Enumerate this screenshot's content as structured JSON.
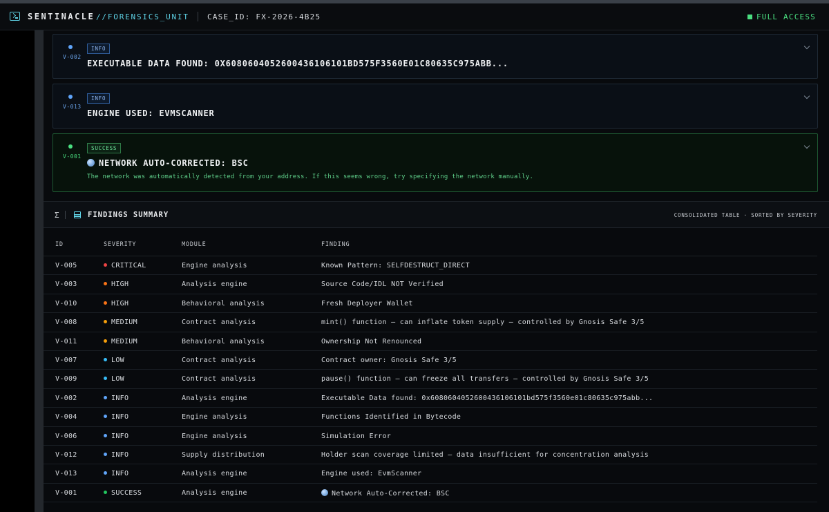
{
  "header": {
    "brand": "SENTINACLE",
    "unit": "//FORENSICS_UNIT",
    "case_id": "CASE_ID: FX-2026-4B25",
    "access": "FULL ACCESS"
  },
  "cards": [
    {
      "id": "V-002",
      "badge": "INFO",
      "title": "EXECUTABLE DATA FOUND: 0X6080604052600436106101BD575F3560E01C80635C975ABB...",
      "description": ""
    },
    {
      "id": "V-013",
      "badge": "INFO",
      "title": "ENGINE USED: EVMSCANNER",
      "description": ""
    },
    {
      "id": "V-001",
      "badge": "SUCCESS",
      "title": "NETWORK AUTO-CORRECTED: BSC",
      "description": "The network was automatically detected from your address. If this seems wrong, try specifying the network manually."
    }
  ],
  "summary": {
    "title": "FINDINGS SUMMARY",
    "sigma": "Σ",
    "meta": "CONSOLIDATED TABLE · SORTED BY SEVERITY"
  },
  "table": {
    "headers": [
      "ID",
      "SEVERITY",
      "MODULE",
      "FINDING"
    ],
    "rows": [
      {
        "id": "V-005",
        "severity": "CRITICAL",
        "module": "Engine analysis",
        "finding": "Known Pattern: SELFDESTRUCT_DIRECT"
      },
      {
        "id": "V-003",
        "severity": "HIGH",
        "module": "Analysis engine",
        "finding": "Source Code/IDL NOT Verified"
      },
      {
        "id": "V-010",
        "severity": "HIGH",
        "module": "Behavioral analysis",
        "finding": "Fresh Deployer Wallet"
      },
      {
        "id": "V-008",
        "severity": "MEDIUM",
        "module": "Contract analysis",
        "finding": "mint() function — can inflate token supply — controlled by Gnosis Safe 3/5"
      },
      {
        "id": "V-011",
        "severity": "MEDIUM",
        "module": "Behavioral analysis",
        "finding": "Ownership Not Renounced"
      },
      {
        "id": "V-007",
        "severity": "LOW",
        "module": "Contract analysis",
        "finding": "Contract owner: Gnosis Safe 3/5"
      },
      {
        "id": "V-009",
        "severity": "LOW",
        "module": "Contract analysis",
        "finding": "pause() function — can freeze all transfers — controlled by Gnosis Safe 3/5"
      },
      {
        "id": "V-002",
        "severity": "INFO",
        "module": "Analysis engine",
        "finding": "Executable Data found: 0x6080604052600436106101bd575f3560e01c80635c975abb..."
      },
      {
        "id": "V-004",
        "severity": "INFO",
        "module": "Engine analysis",
        "finding": "Functions Identified in Bytecode"
      },
      {
        "id": "V-006",
        "severity": "INFO",
        "module": "Engine analysis",
        "finding": "Simulation Error"
      },
      {
        "id": "V-012",
        "severity": "INFO",
        "module": "Supply distribution",
        "finding": "Holder scan coverage limited — data insufficient for concentration analysis"
      },
      {
        "id": "V-013",
        "severity": "INFO",
        "module": "Analysis engine",
        "finding": "Engine used: EvmScanner"
      },
      {
        "id": "V-001",
        "severity": "SUCCESS",
        "module": "Analysis engine",
        "finding": "Network Auto-Corrected: BSC"
      }
    ]
  },
  "severity_colors": {
    "CRITICAL": "#ef4444",
    "HIGH": "#f97316",
    "MEDIUM": "#f59e0b",
    "LOW": "#38bdf8",
    "INFO": "#60a5fa",
    "SUCCESS": "#22c55e"
  }
}
